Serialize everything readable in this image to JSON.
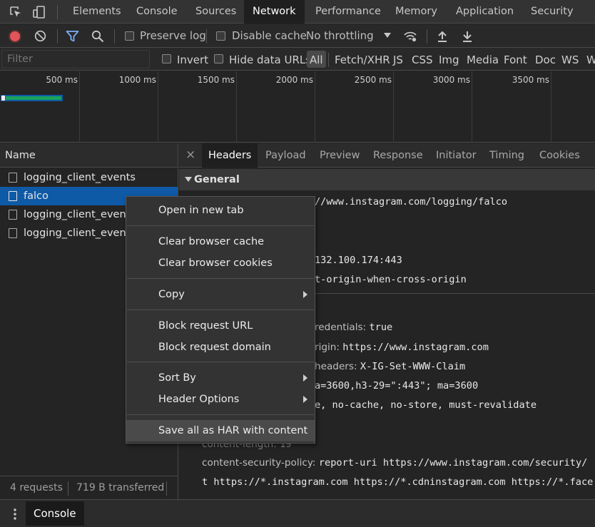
{
  "tabs": [
    "Elements",
    "Console",
    "Sources",
    "Network",
    "Performance",
    "Memory",
    "Application",
    "Security"
  ],
  "active_tab": "Network",
  "toolbar": {
    "preserve_log": "Preserve log",
    "disable_cache": "Disable cache",
    "throttling": "No throttling"
  },
  "filterbar": {
    "placeholder": "Filter",
    "invert": "Invert",
    "hide_data_urls": "Hide data URLs",
    "types": [
      "All",
      "Fetch/XHR",
      "JS",
      "CSS",
      "Img",
      "Media",
      "Font",
      "Doc",
      "WS",
      "W"
    ]
  },
  "overview": {
    "ticks": [
      "500 ms",
      "1000 ms",
      "1500 ms",
      "2000 ms",
      "2500 ms",
      "3000 ms",
      "3500 ms"
    ]
  },
  "requests": {
    "header": "Name",
    "rows": [
      "logging_client_events",
      "falco",
      "logging_client_events",
      "logging_client_events"
    ],
    "selected_index": 1,
    "status_requests": "4 requests",
    "status_transferred": "719 B transferred"
  },
  "detail": {
    "close": "×",
    "tabs": [
      "Headers",
      "Payload",
      "Preview",
      "Response",
      "Initiator",
      "Timing",
      "Cookies"
    ],
    "active_tab": "Headers",
    "general_title": "General",
    "partial_lines": [
      "//www.instagram.com/logging/falco",
      "132.100.174:443",
      "t-origin-when-cross-origin"
    ],
    "headers": [
      {
        "key": "redentials:",
        "value": "true"
      },
      {
        "key": "rigin:",
        "value": "https://www.instagram.com"
      },
      {
        "key": "headers:",
        "value": "X-IG-Set-WWW-Claim"
      },
      {
        "key": "",
        "value": "a=3600,h3-29=\":443\"; ma=3600"
      },
      {
        "key": "",
        "value": "e, no-cache, no-store, must-revalidate"
      },
      {
        "key": "content-length:",
        "value": "19"
      },
      {
        "key": "content-security-policy:",
        "value": "report-uri https://www.instagram.com/security/"
      },
      {
        "key": "",
        "value": "t https://*.instagram.com https://*.cdninstagram.com https://*.face"
      }
    ]
  },
  "context_menu": {
    "items": [
      {
        "label": "Open in new tab"
      },
      {
        "label": "Clear browser cache"
      },
      {
        "label": "Clear browser cookies"
      },
      {
        "label": "Copy"
      },
      {
        "label": "Block request URL"
      },
      {
        "label": "Block request domain"
      },
      {
        "label": "Sort By"
      },
      {
        "label": "Header Options"
      },
      {
        "label": "Save all as HAR with content"
      }
    ]
  },
  "drawer": {
    "tab": "Console"
  },
  "colors": {
    "accent": "#0f5aa6",
    "record": "#e0555a",
    "filter": "#7cacf8"
  }
}
